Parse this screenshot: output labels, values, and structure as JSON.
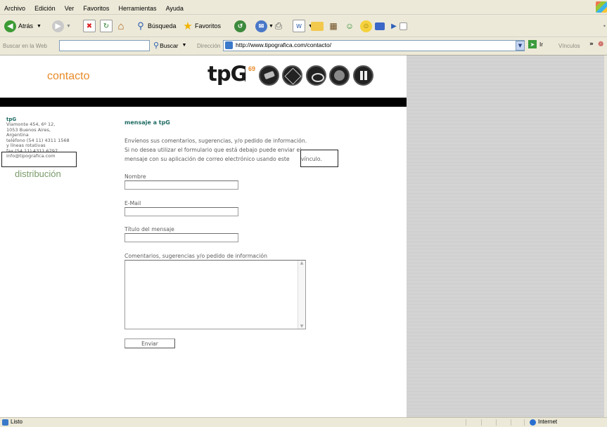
{
  "menu": [
    "Archivo",
    "Edición",
    "Ver",
    "Favoritos",
    "Herramientas",
    "Ayuda"
  ],
  "toolbar": {
    "back_label": "Atrás",
    "search_label": "Búsqueda",
    "favorites_label": "Favoritos"
  },
  "address": {
    "search_placeholder": "Buscar en la Web",
    "search_button": "Buscar",
    "label": "Dirección",
    "url": "http://www.tipografica.com/contacto/",
    "go_label": "Ir",
    "links_label": "Vínculos"
  },
  "header": {
    "section_title": "contacto",
    "logo_text": "tpG",
    "logo_sup": "69"
  },
  "sidebar": {
    "name": "tpG",
    "address_lines": [
      "Viamonte 454, 6º 12,",
      "1053 Buenos Aires,",
      "Argentina",
      "teléfono (54 11) 4311 1568",
      "y líneas rotativas",
      "fax (54 11) 4311 6797"
    ],
    "email": "info@tipografica.com",
    "distribution": "distribución"
  },
  "form": {
    "heading": "mensaje a tpG",
    "intro_line1": "Envíenos sus comentarios, sugerencias, y/o pedido de información.",
    "intro_line2": "Si no desea utilizar el formulario que está debajo puede enviar el",
    "intro_line3": "mensaje con su aplicación de correo electrónico usando este",
    "link_text": "vínculo.",
    "name_label": "Nombre",
    "email_label": "E-Mail",
    "subject_label": "Título del mensaje",
    "comments_label": "Comentarios, sugerencias y/o pedido de información",
    "submit_label": "Enviar"
  },
  "status": {
    "text": "Listo",
    "zone": "Internet"
  },
  "colors": {
    "accent_orange": "#e88b2a",
    "heading_green": "#1f6b63"
  }
}
